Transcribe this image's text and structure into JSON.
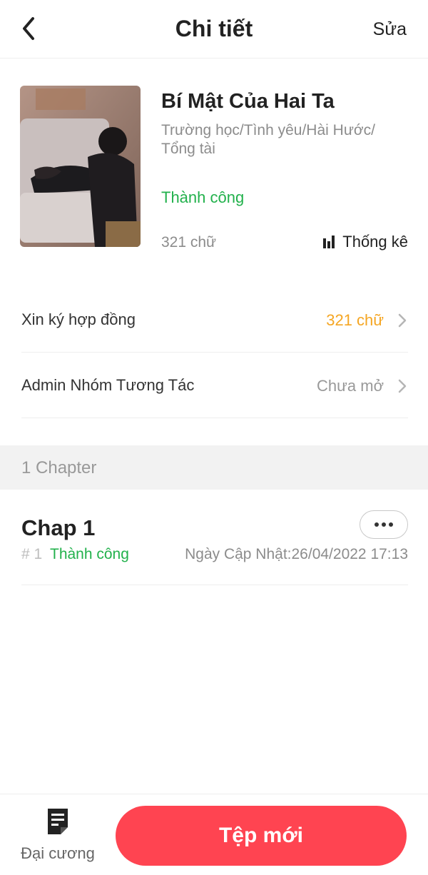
{
  "header": {
    "title": "Chi tiết",
    "edit_label": "Sửa"
  },
  "book": {
    "title": "Bí Mật Của Hai Ta",
    "tags": "Trường học/Tình yêu/Hài Hước/ Tổng tài",
    "status": "Thành công",
    "word_count": "321 chữ",
    "stats_label": "Thống kê"
  },
  "rows": [
    {
      "label": "Xin ký hợp đồng",
      "value": "321 chữ",
      "value_color": "#f5a623"
    },
    {
      "label": "Admin Nhóm Tương Tác",
      "value": "Chưa mở",
      "value_color": "#999999"
    }
  ],
  "section": {
    "label": "1 Chapter"
  },
  "chapters": [
    {
      "title": "Chap 1",
      "number": "# 1",
      "status": "Thành công",
      "updated": "Ngày Cập Nhật:26/04/2022 17:13"
    }
  ],
  "footer": {
    "outline_label": "Đại cương",
    "new_label": "Tệp mới"
  },
  "colors": {
    "success": "#22b14c",
    "accent": "#ff4451",
    "warning": "#f5a623"
  },
  "icons": [
    "back-arrow-icon",
    "bar-chart-icon",
    "chevron-right-icon",
    "more-dots-icon",
    "document-icon"
  ]
}
